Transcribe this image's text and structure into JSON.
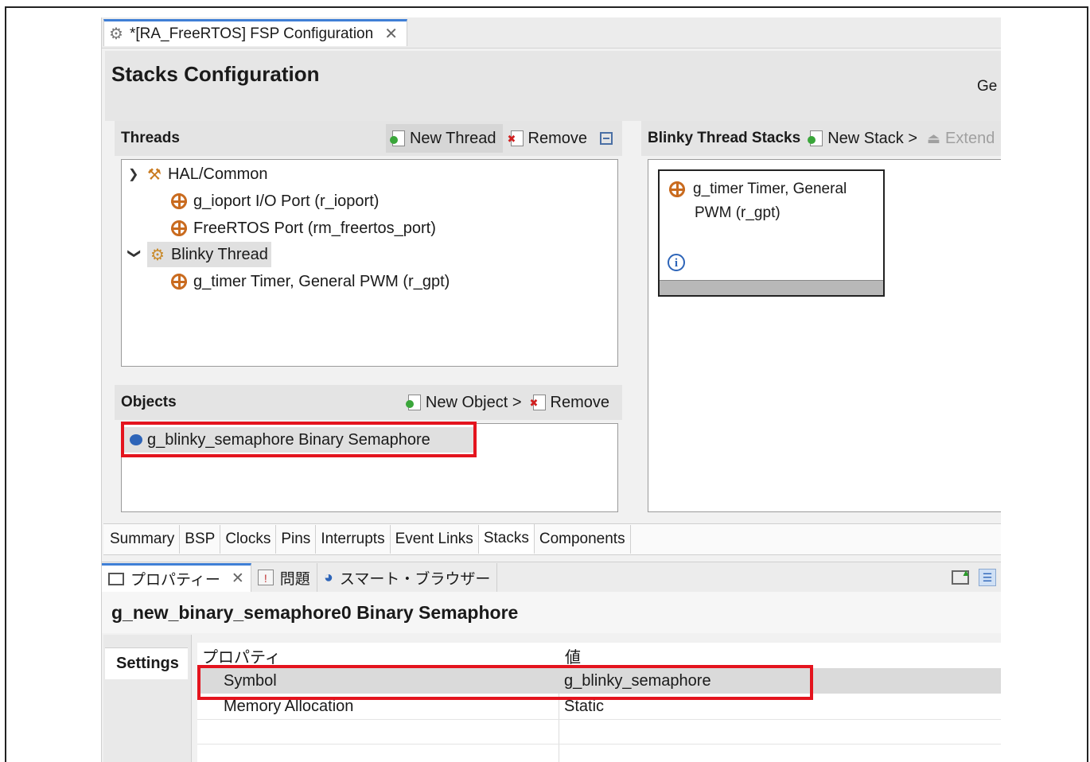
{
  "editor": {
    "tab_title": "*[RA_FreeRTOS] FSP Configuration",
    "title": "Stacks Configuration",
    "right_label": "Ge"
  },
  "threads": {
    "header": "Threads",
    "new_thread": "New Thread",
    "remove": "Remove",
    "tree": [
      {
        "label": "HAL/Common"
      },
      {
        "label": "g_ioport I/O Port (r_ioport)"
      },
      {
        "label": "FreeRTOS Port (rm_freertos_port)"
      },
      {
        "label": "Blinky Thread"
      },
      {
        "label": "g_timer Timer, General PWM (r_gpt)"
      }
    ]
  },
  "stacks": {
    "header": "Blinky Thread Stacks",
    "new_stack": "New Stack >",
    "extend": "Extend",
    "block_line1": "g_timer Timer, General",
    "block_line2": "PWM (r_gpt)"
  },
  "objects": {
    "header": "Objects",
    "new_object": "New Object >",
    "remove": "Remove",
    "items": [
      {
        "label": "g_blinky_semaphore Binary Semaphore"
      }
    ]
  },
  "bottom_tabs": [
    "Summary",
    "BSP",
    "Clocks",
    "Pins",
    "Interrupts",
    "Event Links",
    "Stacks",
    "Components"
  ],
  "properties": {
    "tabs": [
      "プロパティー",
      "問題",
      "スマート・ブラウザー"
    ],
    "title": "g_new_binary_semaphore0 Binary Semaphore",
    "settings_tab": "Settings",
    "col_property": "プロパティ",
    "col_value": "値",
    "rows": [
      {
        "name": "Symbol",
        "value": "g_blinky_semaphore"
      },
      {
        "name": "Memory Allocation",
        "value": "Static"
      }
    ]
  },
  "colors": {
    "highlight": "#e4141e",
    "accent": "#3f7fd6"
  }
}
